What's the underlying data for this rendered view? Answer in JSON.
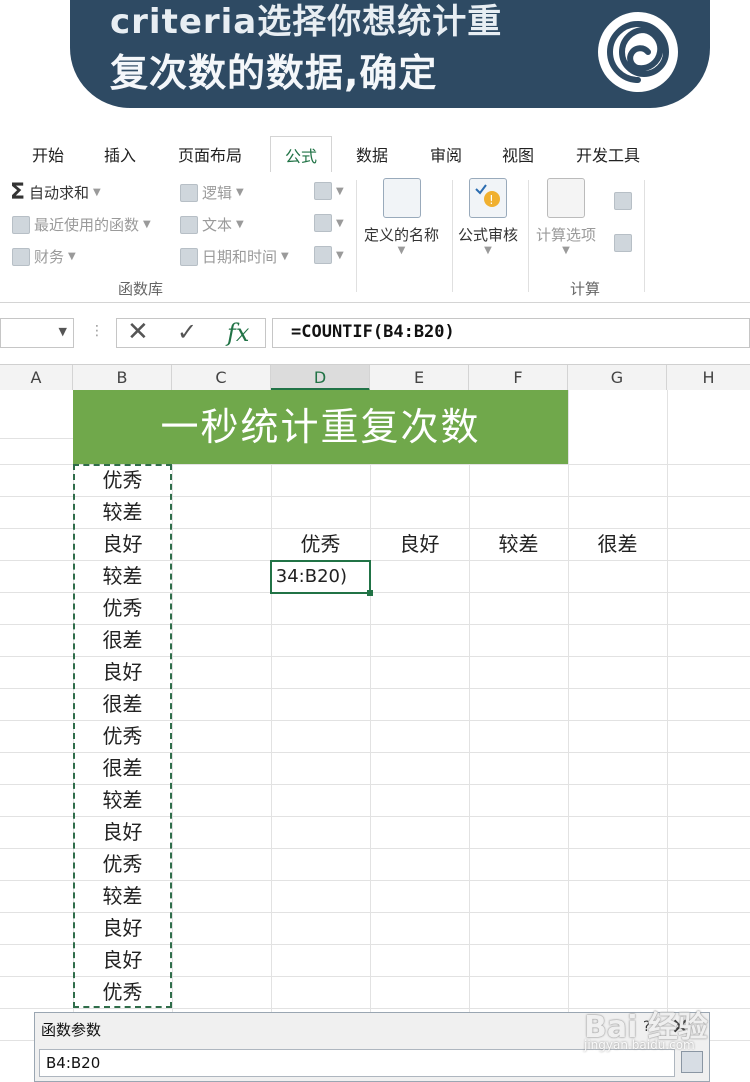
{
  "banner": {
    "line1": "criteria选择你想统计重",
    "line2": "复次数的数据,确定"
  },
  "ribbon": {
    "tabs": [
      "开始",
      "插入",
      "页面布局",
      "公式",
      "数据",
      "审阅",
      "视图",
      "开发工具"
    ],
    "active_tab": "公式",
    "function_library": {
      "autosum": "自动求和",
      "recent": "最近使用的函数",
      "financial": "财务",
      "logical": "逻辑",
      "text": "文本",
      "datetime": "日期和时间",
      "group_label": "函数库"
    },
    "defined_names": "定义的名称",
    "formula_auditing": "公式审核",
    "calc_options": "计算选项",
    "calc_group_label": "计算"
  },
  "formula_bar": {
    "name_box": "",
    "formula": "=COUNTIF(B4:B20)"
  },
  "columns": [
    "A",
    "B",
    "C",
    "D",
    "E",
    "F",
    "G",
    "H"
  ],
  "selected_column": "D",
  "sheet": {
    "title": "一秒统计重复次数",
    "b_values": [
      "优秀",
      "较差",
      "良好",
      "较差",
      "优秀",
      "很差",
      "良好",
      "很差",
      "优秀",
      "很差",
      "较差",
      "良好",
      "优秀",
      "较差",
      "良好",
      "良好",
      "优秀"
    ],
    "headers": [
      "优秀",
      "良好",
      "较差",
      "很差"
    ],
    "active_cell_text": "34:B20)"
  },
  "dialog": {
    "title": "函数参数",
    "input_value": "B4:B20",
    "help": "?",
    "close": "✕"
  },
  "watermark": {
    "text": "Bai 经验",
    "sub": "jingyan.baidu.com"
  },
  "colors": {
    "accent": "#217346",
    "title_band": "#70a84b",
    "banner": "#2e4a63"
  }
}
